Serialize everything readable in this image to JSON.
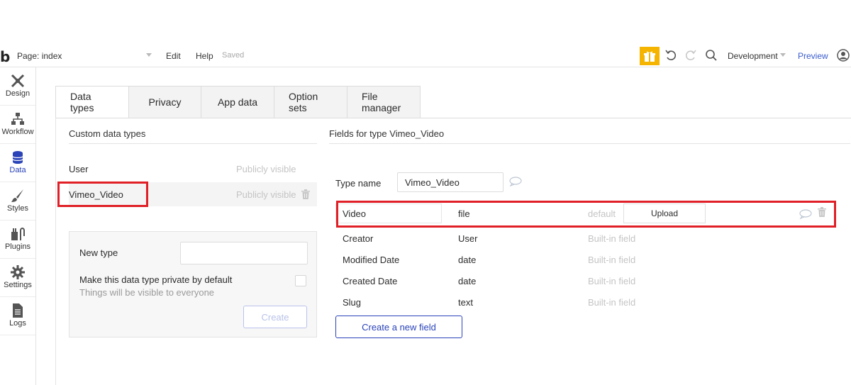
{
  "topbar": {
    "logo": "b",
    "page_label": "Page: index",
    "edit": "Edit",
    "help": "Help",
    "saved": "Saved",
    "environment": "Development",
    "preview": "Preview",
    "gift_color": "#f4b400"
  },
  "sidebar": {
    "items": [
      {
        "label": "Design",
        "icon": "design-icon"
      },
      {
        "label": "Workflow",
        "icon": "workflow-icon"
      },
      {
        "label": "Data",
        "icon": "data-icon",
        "active": true
      },
      {
        "label": "Styles",
        "icon": "styles-icon"
      },
      {
        "label": "Plugins",
        "icon": "plugins-icon"
      },
      {
        "label": "Settings",
        "icon": "settings-icon"
      },
      {
        "label": "Logs",
        "icon": "logs-icon"
      }
    ]
  },
  "tabs": [
    {
      "label": "Data types",
      "active": true
    },
    {
      "label": "Privacy"
    },
    {
      "label": "App data"
    },
    {
      "label": "Option sets"
    },
    {
      "label": "File manager"
    }
  ],
  "custom_types": {
    "title": "Custom data types",
    "rows": [
      {
        "name": "User",
        "visibility": "Publicly visible"
      },
      {
        "name": "Vimeo_Video",
        "visibility": "Publicly visible",
        "selected": true
      }
    ],
    "new_type": {
      "label": "New type",
      "input_value": "",
      "private_label": "Make this data type private by default",
      "private_sub": "Things will be visible to everyone",
      "create_label": "Create"
    }
  },
  "fields": {
    "title": "Fields for type Vimeo_Video",
    "type_name_label": "Type name",
    "type_name_value": "Vimeo_Video",
    "rows": [
      {
        "name": "Video",
        "type": "file",
        "extra": "default",
        "upload_label": "Upload"
      },
      {
        "name": "Creator",
        "type": "User",
        "extra": "Built-in field"
      },
      {
        "name": "Modified Date",
        "type": "date",
        "extra": "Built-in field"
      },
      {
        "name": "Created Date",
        "type": "date",
        "extra": "Built-in field"
      },
      {
        "name": "Slug",
        "type": "text",
        "extra": "Built-in field"
      }
    ],
    "create_field_label": "Create a new field"
  },
  "colors": {
    "accent": "#2a43b8",
    "highlight": "#e01f26",
    "muted": "#c4c4c4"
  }
}
